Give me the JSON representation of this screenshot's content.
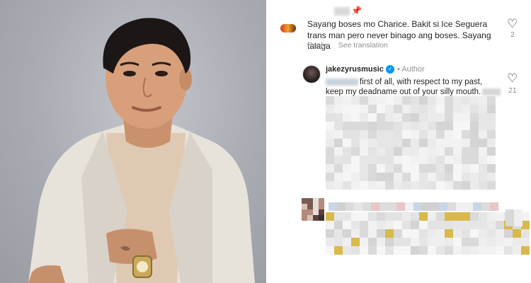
{
  "comment1": {
    "text": "Sayang boses mo Charice. Bakit si Ice Seguera trans man pero never binago ang boses. Sayang talaga",
    "reply_label": "Reply",
    "translation_label": "See translation",
    "like_count": "2",
    "pinned_icon": "pin-icon",
    "like_icon": "heart-outline-icon"
  },
  "comment2": {
    "username": "jakezyrusmusic",
    "badge_icon": "verified-badge-icon",
    "separator": "•",
    "author_label": "Author",
    "line1": "first of all, with respect to my past,",
    "line2": "keep my deadname out of your silly mouth.",
    "like_count": "21",
    "like_icon": "heart-outline-icon"
  },
  "colors": {
    "verified": "#0095f6",
    "secondary_text": "#8e8e8e",
    "primary_text": "#262626"
  }
}
